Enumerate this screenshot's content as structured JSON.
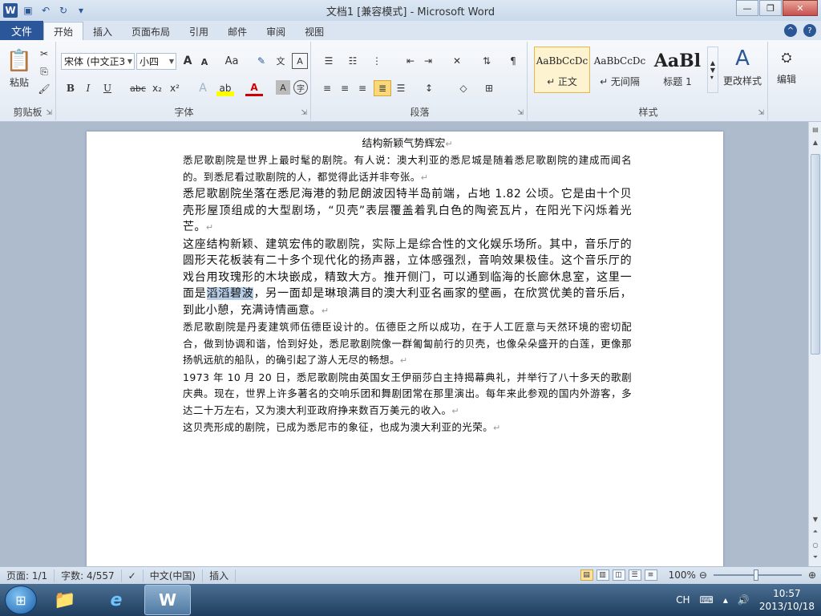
{
  "window": {
    "title": "文档1 [兼容模式] - Microsoft Word"
  },
  "tabs": [
    "文件",
    "开始",
    "插入",
    "页面布局",
    "引用",
    "邮件",
    "审阅",
    "视图"
  ],
  "ribbon": {
    "clipboard": {
      "label": "剪贴板",
      "paste": "粘贴"
    },
    "font": {
      "label": "字体",
      "font_name": "宋体 (中文正3",
      "font_size": "小四",
      "grow": "A",
      "shrink": "A",
      "change_case": "Aa",
      "bold": "B",
      "italic": "I",
      "underline": "U",
      "strike": "abc",
      "subscript": "x₂",
      "superscript": "x²"
    },
    "paragraph": {
      "label": "段落"
    },
    "styles": {
      "label": "样式",
      "items": [
        {
          "sample": "AaBbCcDc",
          "name": "↵ 正文"
        },
        {
          "sample": "AaBbCcDc",
          "name": "↵ 无间隔"
        },
        {
          "sample": "AaBl",
          "name": "标题 1"
        }
      ],
      "change_styles": "更改样式"
    },
    "editing": {
      "label": "编辑"
    }
  },
  "document": {
    "title": "结构新颖气势辉宏",
    "paragraphs": [
      {
        "text": "悉尼歌剧院是世界上最时髦的剧院。有人说：澳大利亚的悉尼城是随着悉尼歌剧院的建成而闻名的。到悉尼看过歌剧院的人，都觉得此话并非夸张。",
        "style": "small"
      },
      {
        "text": "悉尼歌剧院坐落在悉尼海港的勃尼朗波因特半岛前端，占地 1.82 公顷。它是由十个贝壳形屋顶组成的大型剧场，“贝壳”表层覆盖着乳白色的陶瓷瓦片，在阳光下闪烁着光芒。",
        "style": "normal"
      },
      {
        "text_before": "这座结构新颖、建筑宏伟的歌剧院，实际上是综合性的文化娱乐场所。其中，音乐厅的圆形天花板装有二十多个现代化的扬声器，立体感强烈，音响效果极佳。这个音乐厅的戏台用玫瑰形的木块嵌成，精致大方。推开侧门，可以通到临海的长廊休息室，这里一面是",
        "highlight": "滔滔碧波",
        "text_after": "，另一面却是琳琅满目的澳大利亚名画家的壁画，在欣赏优美的音乐后，到此小憩，充满诗情画意。",
        "style": "normal"
      },
      {
        "text": "悉尼歌剧院是丹麦建筑师伍德臣设计的。伍德臣之所以成功，在于人工匠意与天然环境的密切配合，做到协调和谐，恰到好处，悉尼歌剧院像一群匍匐前行的贝壳，也像朵朵盛开的白莲，更像那扬帆远航的船队，的确引起了游人无尽的畅想。",
        "style": "small"
      },
      {
        "text": "1973 年 10 月 20 日，悉尼歌剧院由英国女王伊丽莎白主持揭幕典礼，并举行了八十多天的歌剧庆典。现在，世界上许多著名的交响乐团和舞剧团常在那里演出。每年来此参观的国内外游客，多达二十万左右，又为澳大利亚政府挣来数百万美元的收入。",
        "style": "small"
      },
      {
        "text": "这贝壳形成的剧院，已成为悉尼市的象征，也成为澳大利亚的光荣。",
        "style": "small"
      }
    ],
    "para_mark": "↵"
  },
  "status": {
    "page": "页面: 1/1",
    "words": "字数: 4/557",
    "language": "中文(中国)",
    "mode": "插入",
    "zoom": "100%"
  },
  "taskbar": {
    "ime": "CH",
    "time": "10:57",
    "date": "2013/10/18"
  },
  "colors": {
    "file_tab": "#2b579a",
    "selection": "#b9cfe8"
  }
}
